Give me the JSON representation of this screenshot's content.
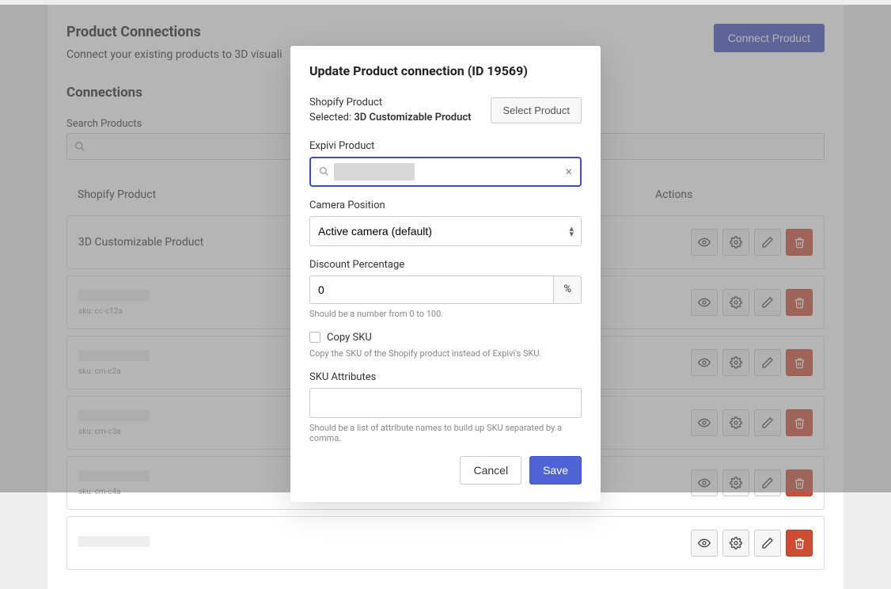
{
  "page": {
    "title": "Product Connections",
    "subtitle": "Connect your existing products to 3D visuali",
    "connect_button": "Connect Product",
    "connections_heading": "Connections",
    "search_label": "Search Products"
  },
  "table": {
    "col_product": "Shopify Product",
    "col_actions": "Actions",
    "rows": [
      {
        "name": "3D Customizable Product",
        "sku": ""
      },
      {
        "name": "",
        "sku": "sku: cc-c12a"
      },
      {
        "name": "",
        "sku": "sku: cm-c2a"
      },
      {
        "name": "",
        "sku": "sku: cm-c3a"
      },
      {
        "name": "",
        "sku": "sku: cm-c4a"
      },
      {
        "name": "",
        "sku": ""
      }
    ]
  },
  "modal": {
    "title": "Update Product connection (ID 19569)",
    "shopify_label": "Shopify Product",
    "selected_prefix": "Selected:",
    "selected_name": "3D Customizable Product",
    "select_product_btn": "Select Product",
    "expivi_label": "Expivi Product",
    "camera_label": "Camera Position",
    "camera_value": "Active camera (default)",
    "discount_label": "Discount Percentage",
    "discount_value": "0",
    "discount_suffix": "%",
    "discount_hint": "Should be a number from 0 to 100.",
    "copy_sku_label": "Copy SKU",
    "copy_sku_hint": "Copy the SKU of the Shopify product instead of Expivi's SKU.",
    "sku_attr_label": "SKU Attributes",
    "sku_attr_hint": "Should be a list of attribute names to build up SKU separated by a comma.",
    "cancel": "Cancel",
    "save": "Save"
  }
}
